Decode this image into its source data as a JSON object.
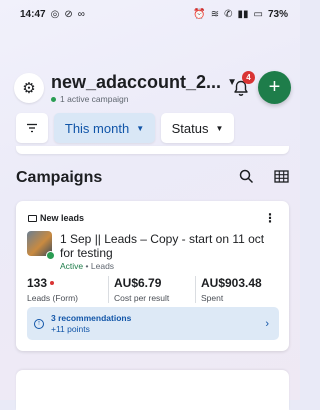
{
  "status_bar": {
    "time": "14:47",
    "left_icons": [
      "shield-icon",
      "block-icon",
      "meta-icon"
    ],
    "right_icons": [
      "alarm-icon",
      "wifi-icon",
      "call-icon",
      "lte-icon",
      "signal-icon",
      "signal-icon"
    ],
    "battery": "73%"
  },
  "header": {
    "account_name": "new_adaccount_2...",
    "active_campaigns": "1 active campaign",
    "notifications_count": "4",
    "add_label": "+"
  },
  "filters": {
    "date_range": "This month",
    "status": "Status"
  },
  "campaigns_section": {
    "title": "Campaigns"
  },
  "campaign": {
    "objective": "New leads",
    "name": "1 Sep || Leads – Copy - start on 11 oct for testing",
    "state": "Active",
    "separator": "•",
    "type": "Leads",
    "metrics": [
      {
        "value": "133",
        "label": "Leads (Form)"
      },
      {
        "value": "AU$6.79",
        "label": "Cost per result"
      },
      {
        "value": "AU$903.48",
        "label": "Spent"
      }
    ],
    "recommendations": {
      "title": "3 recommendations",
      "points": "+11 points"
    }
  },
  "colors": {
    "accent_blue": "#1155a8",
    "active_green": "#1e7d4a",
    "badge_red": "#d93434"
  }
}
